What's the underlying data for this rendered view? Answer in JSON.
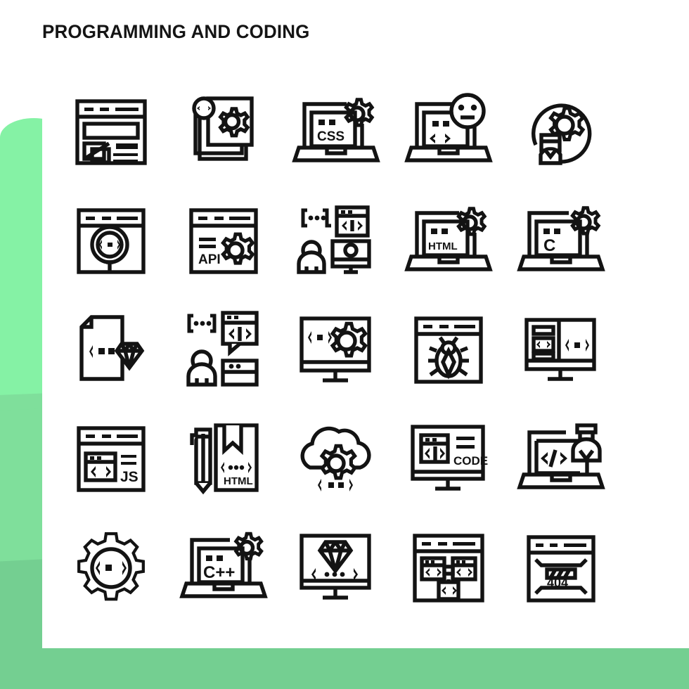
{
  "page": {
    "title": "PROGRAMMING AND CODING",
    "background_color": "#ffffff",
    "card_color": "#ffffff",
    "icon_color": "#131313",
    "accent_green_light": "#85f2a5",
    "accent_green_mid": "#7fdf9b",
    "accent_green_dark": "#74cf91"
  },
  "grid": {
    "columns": 5,
    "rows": 5,
    "count": 25
  },
  "icons": [
    {
      "id": "web-layout",
      "name": "browser-layout-icon",
      "label": ""
    },
    {
      "id": "code-documents-gear",
      "name": "document-stack-gear-icon",
      "label": ""
    },
    {
      "id": "css-laptop",
      "name": "laptop-css-gear-icon",
      "label": "CSS"
    },
    {
      "id": "laptop-face",
      "name": "laptop-code-face-icon",
      "label": ""
    },
    {
      "id": "gear-user-circle",
      "name": "gear-user-circle-icon",
      "label": ""
    },
    {
      "id": "code-search",
      "name": "browser-code-search-icon",
      "label": ""
    },
    {
      "id": "api-browser",
      "name": "browser-api-gear-icon",
      "label": "API"
    },
    {
      "id": "developer-monitor",
      "name": "developer-monitor-icon",
      "label": ""
    },
    {
      "id": "html-laptop",
      "name": "laptop-html-gear-icon",
      "label": "HTML"
    },
    {
      "id": "c-laptop",
      "name": "laptop-c-gear-icon",
      "label": "C"
    },
    {
      "id": "ruby-file",
      "name": "document-ruby-code-icon",
      "label": ""
    },
    {
      "id": "code-chat-person",
      "name": "code-chat-person-icon",
      "label": ""
    },
    {
      "id": "monitor-code-gear",
      "name": "monitor-code-gear-icon",
      "label": ""
    },
    {
      "id": "bug-browser",
      "name": "browser-bug-icon",
      "label": ""
    },
    {
      "id": "monitor-split-code",
      "name": "monitor-split-code-icon",
      "label": ""
    },
    {
      "id": "js-browser",
      "name": "browser-js-icon",
      "label": "JS"
    },
    {
      "id": "html-pencil-doc",
      "name": "pencil-html-document-icon",
      "label": "HTML"
    },
    {
      "id": "cloud-gear-code",
      "name": "cloud-gear-code-icon",
      "label": ""
    },
    {
      "id": "code-monitor",
      "name": "monitor-code-label-icon",
      "label": "CODE"
    },
    {
      "id": "student-laptop",
      "name": "laptop-student-code-icon",
      "label": ""
    },
    {
      "id": "gear-code",
      "name": "gear-code-icon",
      "label": ""
    },
    {
      "id": "cpp-laptop",
      "name": "laptop-cpp-gear-icon",
      "label": "C++"
    },
    {
      "id": "monitor-diamond",
      "name": "monitor-diamond-code-icon",
      "label": ""
    },
    {
      "id": "api-modules",
      "name": "browser-code-modules-icon",
      "label": ""
    },
    {
      "id": "error-404",
      "name": "browser-404-error-icon",
      "label": "404"
    }
  ],
  "icon_texts": {
    "css": "CSS",
    "api": "API",
    "html": "HTML",
    "c": "C",
    "js": "JS",
    "code": "CODE",
    "cpp": "C++",
    "error": "404",
    "code_brace": "{..}",
    "code_tag": "</>"
  }
}
